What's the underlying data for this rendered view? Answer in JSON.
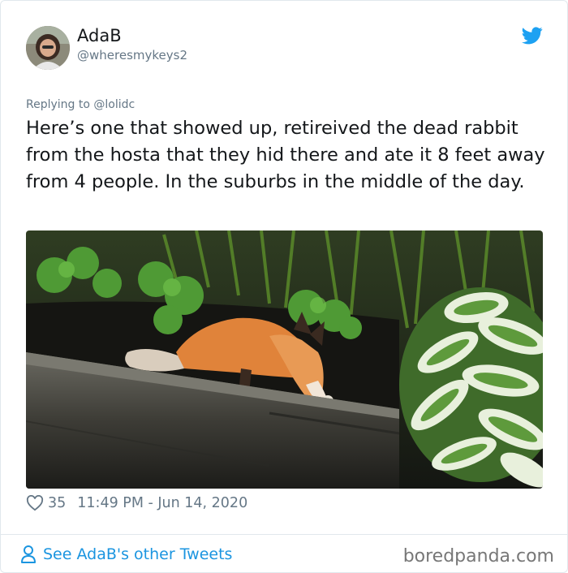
{
  "author": {
    "name": "AdaB",
    "handle": "@wheresmykeys2",
    "avatar_icon": "user-avatar-photo"
  },
  "brand_icon": "twitter-bird-icon",
  "reply": {
    "prefix": "Replying to ",
    "target": "@lolidc"
  },
  "tweet": {
    "text": "Here’s one that showed up, retireived the dead rabbit from the hosta that they hid there and ate it 8 feet away from 4 people. In the suburbs in the middle of the day.",
    "image_description": "fox"
  },
  "meta": {
    "likes": "35",
    "timestamp": "11:49 PM - Jun 14, 2020",
    "like_icon": "heart-icon"
  },
  "footer": {
    "see_tweets": "See AdaB's other Tweets",
    "see_tweets_icon": "person-icon",
    "watermark": "boredpanda.com"
  },
  "colors": {
    "accent": "#1b95e0",
    "twitter_blue": "#1da1f2",
    "muted": "#657786",
    "text": "#14171a"
  }
}
